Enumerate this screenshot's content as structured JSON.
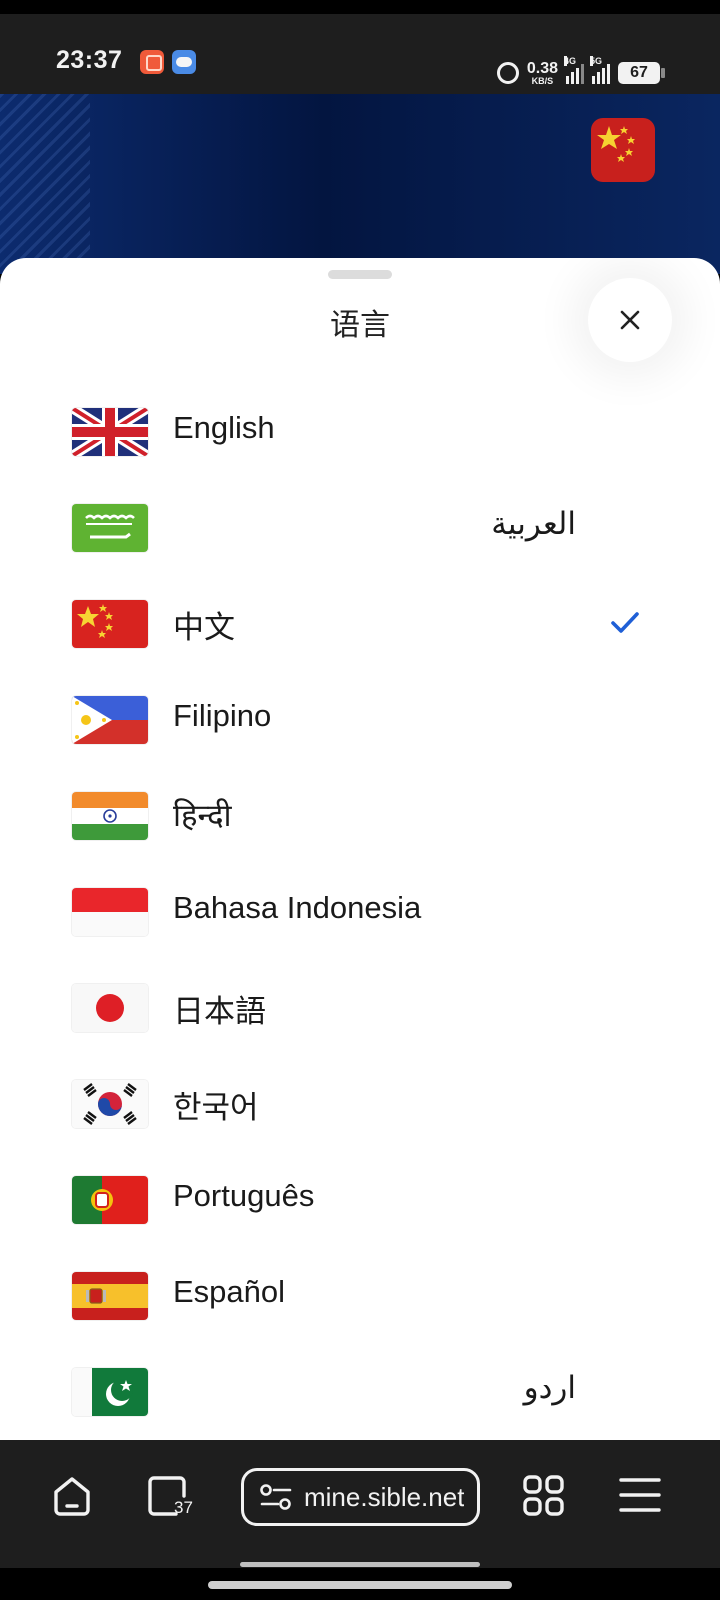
{
  "status_bar": {
    "time": "23:37",
    "net_speed": "0.38",
    "net_speed_unit": "KB/S",
    "signal1_label": "4G",
    "signal2_label": "5G",
    "battery": "67"
  },
  "sheet": {
    "title": "语言",
    "close_icon": "close-icon",
    "selected_index": 2,
    "languages": [
      {
        "label": "English",
        "flag": "gb-flag-icon"
      },
      {
        "label": "العربية",
        "flag": "sa-flag-icon"
      },
      {
        "label": "中文",
        "flag": "cn-flag-icon"
      },
      {
        "label": "Filipino",
        "flag": "ph-flag-icon"
      },
      {
        "label": "हिन्दी",
        "flag": "in-flag-icon"
      },
      {
        "label": "Bahasa Indonesia",
        "flag": "id-flag-icon"
      },
      {
        "label": "日本語",
        "flag": "jp-flag-icon"
      },
      {
        "label": "한국어",
        "flag": "kr-flag-icon"
      },
      {
        "label": "Português",
        "flag": "pt-flag-icon"
      },
      {
        "label": "Español",
        "flag": "es-flag-icon"
      },
      {
        "label": "اردو",
        "flag": "pk-flag-icon"
      }
    ]
  },
  "browser_bar": {
    "tab_count": "37",
    "url": "mine.sible.net"
  },
  "colors": {
    "accent": "#1f5fd6",
    "nav_bg": "#1e1e1e"
  }
}
